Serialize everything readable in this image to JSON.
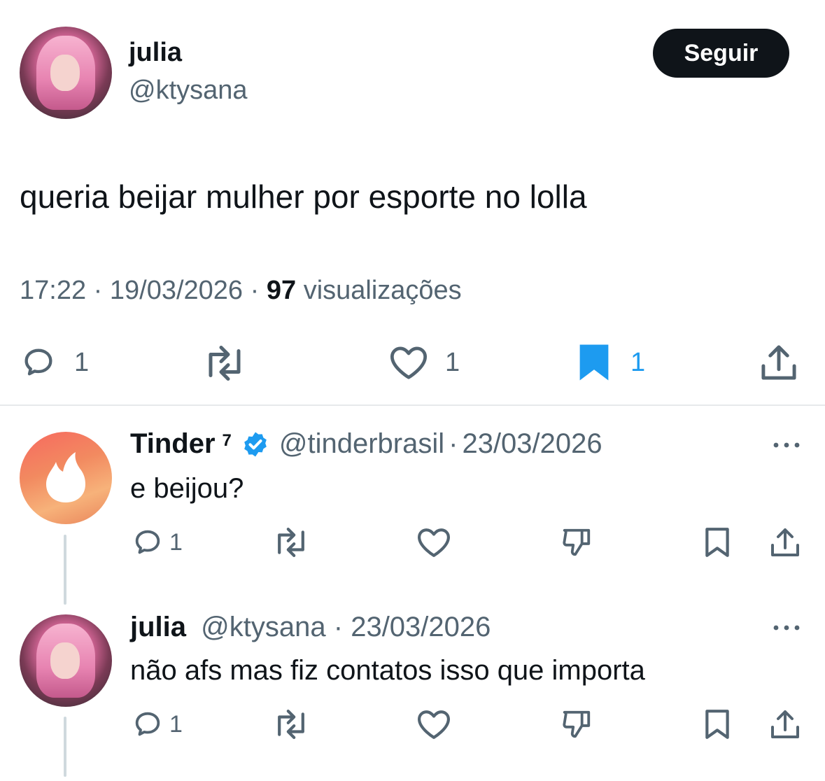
{
  "tweet": {
    "author_name": "julia",
    "author_handle": "@ktysana",
    "follow_label": "Seguir",
    "text": "queria beijar mulher por esporte no lolla",
    "time": "17:22",
    "date": "19/03/2026",
    "views_count": "97",
    "views_label": "visualizações",
    "separator": "·",
    "reply_count": "1",
    "like_count": "1",
    "bookmark_count": "1",
    "bookmark_color": "#1d9bf0"
  },
  "replies": [
    {
      "name": "Tinder",
      "affiliate_badge": "7",
      "verified": true,
      "handle": "@tinderbrasil",
      "separator": "·",
      "date": "23/03/2026",
      "text": "e beijou?",
      "reply_count": "1"
    },
    {
      "name": "julia",
      "handle": "@ktysana",
      "separator": "·",
      "date": "23/03/2026",
      "text": "não afs mas fiz contatos isso que importa",
      "reply_count": "1"
    }
  ],
  "icons": [
    "reply-icon",
    "retweet-icon",
    "like-icon",
    "bookmark-icon",
    "share-icon",
    "dislike-icon",
    "more-icon",
    "verified-icon",
    "tinder-flame-icon"
  ]
}
